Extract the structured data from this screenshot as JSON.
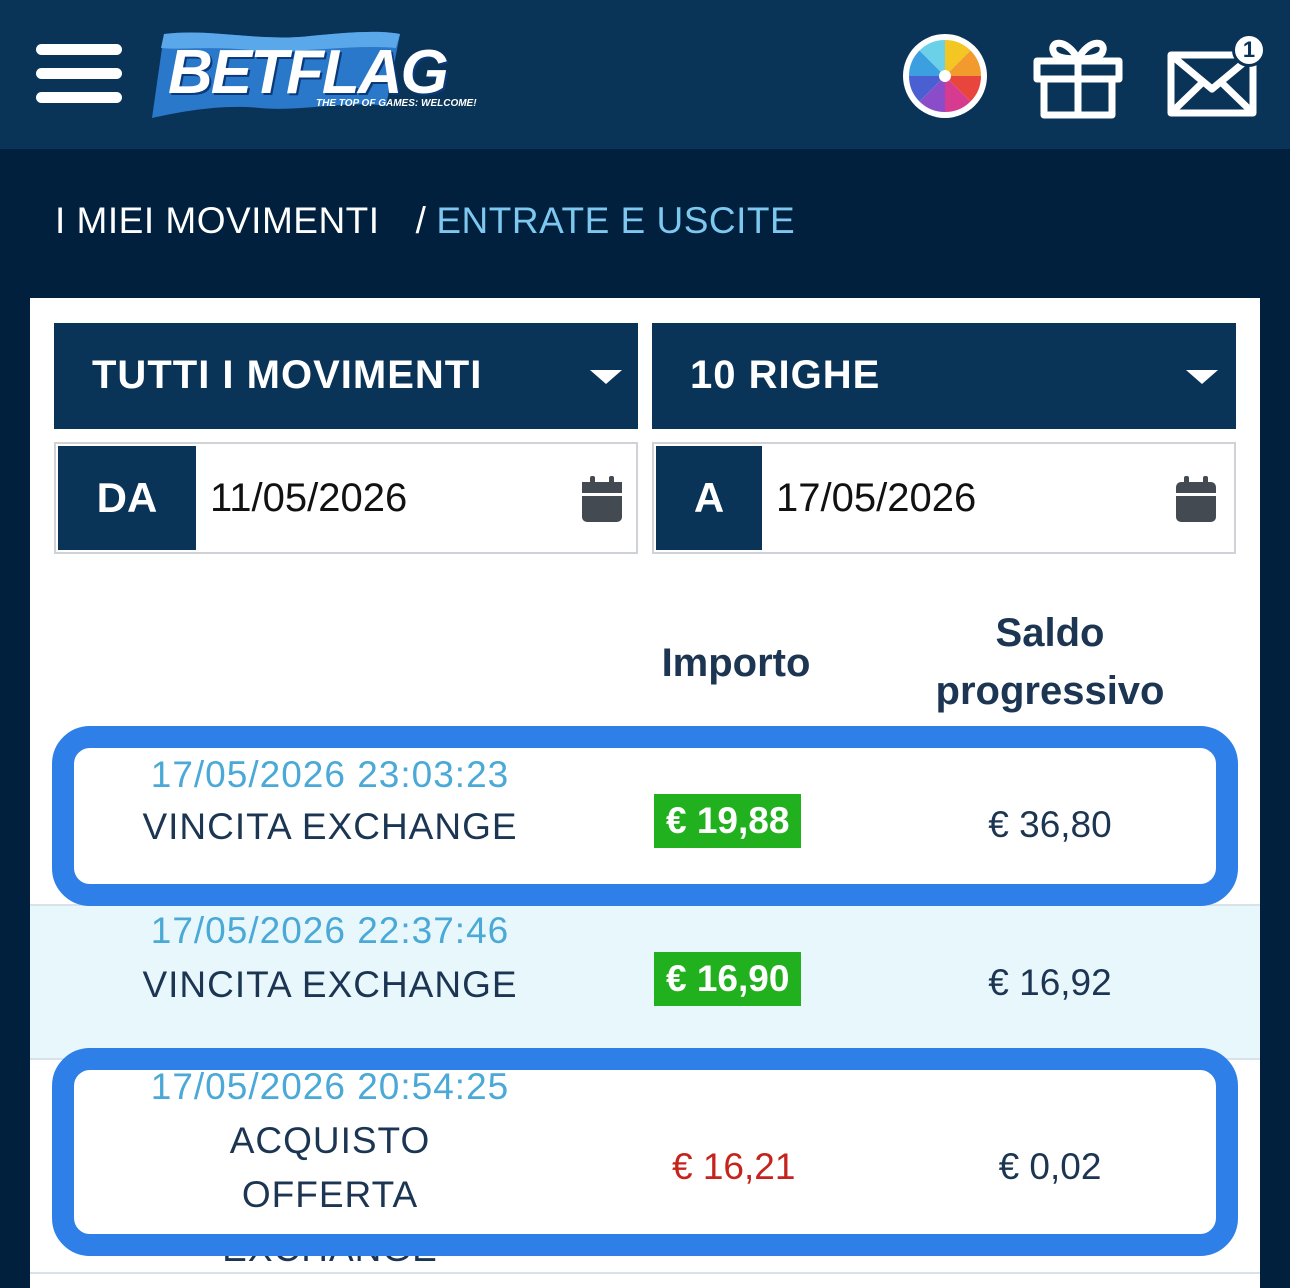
{
  "header": {
    "menu_icon": "hamburger-menu-icon",
    "logo_text": "BETFLAG",
    "logo_tagline": "THE TOP OF GAMES: WELCOME!",
    "wheel_icon": "wheel-of-fortune-icon",
    "gift_icon": "gift-icon",
    "mail_icon": "mail-icon",
    "mail_badge": "1"
  },
  "breadcrumb": {
    "parent": "I MIEI MOVIMENTI",
    "separator": "/",
    "current": "ENTRATE E USCITE"
  },
  "filters": {
    "type_select": "TUTTI I MOVIMENTI",
    "rows_select": "10 RIGHE",
    "from_label": "DA",
    "from_value": "11/05/2026",
    "to_label": "A",
    "to_value": "17/05/2026"
  },
  "table": {
    "col_importo": "Importo",
    "col_saldo": "Saldo progressivo",
    "rows": [
      {
        "datetime": "17/05/2026 23:03:23",
        "description": "VINCITA EXCHANGE",
        "amount": "€ 19,88",
        "balance": "€ 36,80",
        "amount_type": "positive"
      },
      {
        "datetime": "17/05/2026 22:37:46",
        "description": "VINCITA EXCHANGE",
        "amount": "€ 16,90",
        "balance": "€ 16,92",
        "amount_type": "positive"
      },
      {
        "datetime": "17/05/2026 20:54:25",
        "description": "ACQUISTO OFFERTA EXCHANGE",
        "amount": "€ 16,21",
        "balance": "€ 0,02",
        "amount_type": "negative"
      }
    ]
  },
  "colors": {
    "header_bg": "#0a3358",
    "page_bg": "#00203d",
    "accent_link": "#7ec8f0",
    "positive_amount": "#22b11e",
    "negative_amount": "#c5241d",
    "highlight_outline": "#2f7fe8"
  }
}
